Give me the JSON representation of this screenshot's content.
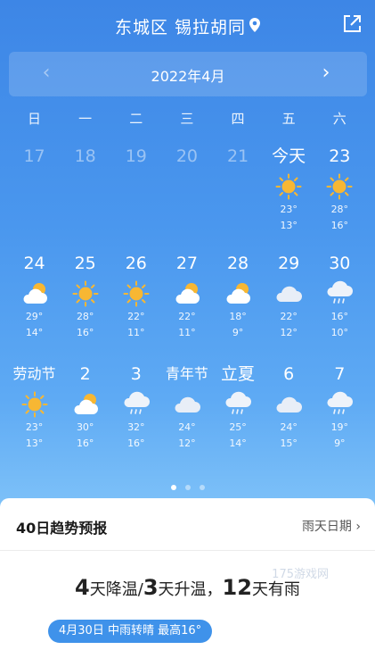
{
  "header": {
    "location": "东城区 锡拉胡同",
    "pin_icon": "location-pin-icon",
    "share_icon": "share-icon"
  },
  "month_bar": {
    "title": "2022年4月",
    "prev": "‹",
    "next": "›"
  },
  "weekdays": [
    "日",
    "一",
    "二",
    "三",
    "四",
    "五",
    "六"
  ],
  "rows": [
    [
      {
        "day": "17",
        "muted": true
      },
      {
        "day": "18",
        "muted": true
      },
      {
        "day": "19",
        "muted": true
      },
      {
        "day": "20",
        "muted": true
      },
      {
        "day": "21",
        "muted": true
      },
      {
        "day": "今天",
        "icon": "sun",
        "high": "23°",
        "low": "13°"
      },
      {
        "day": "23",
        "icon": "sun",
        "high": "28°",
        "low": "16°"
      }
    ],
    [
      {
        "day": "24",
        "icon": "partly",
        "high": "29°",
        "low": "14°"
      },
      {
        "day": "25",
        "icon": "sun",
        "high": "28°",
        "low": "16°"
      },
      {
        "day": "26",
        "icon": "sun",
        "high": "22°",
        "low": "11°"
      },
      {
        "day": "27",
        "icon": "partly",
        "high": "22°",
        "low": "11°"
      },
      {
        "day": "28",
        "icon": "partly",
        "high": "18°",
        "low": "9°"
      },
      {
        "day": "29",
        "icon": "cloud",
        "high": "22°",
        "low": "12°"
      },
      {
        "day": "30",
        "icon": "rain",
        "high": "16°",
        "low": "10°"
      }
    ],
    [
      {
        "day": "劳动节",
        "icon": "sun",
        "high": "23°",
        "low": "13°"
      },
      {
        "day": "2",
        "icon": "partly",
        "high": "30°",
        "low": "16°"
      },
      {
        "day": "3",
        "icon": "rain",
        "high": "32°",
        "low": "16°"
      },
      {
        "day": "青年节",
        "icon": "cloud",
        "high": "24°",
        "low": "12°"
      },
      {
        "day": "立夏",
        "icon": "rain",
        "high": "25°",
        "low": "14°"
      },
      {
        "day": "6",
        "icon": "cloud",
        "high": "24°",
        "low": "15°"
      },
      {
        "day": "7",
        "icon": "rain",
        "high": "19°",
        "low": "9°"
      }
    ]
  ],
  "card": {
    "title": "40日趋势预报",
    "rainy_days": "雨天日期 ›",
    "summary": {
      "cool_days": "4",
      "cool_label": "天降温/",
      "warm_days": "3",
      "warm_label": "天升温，",
      "rain_days": "12",
      "rain_label": "天有雨"
    },
    "pill": "4月30日 中雨转晴 最高16°",
    "watermark": "175游戏网"
  },
  "colors": {
    "accent": "#3f92ea",
    "sun": "#f7b733"
  }
}
